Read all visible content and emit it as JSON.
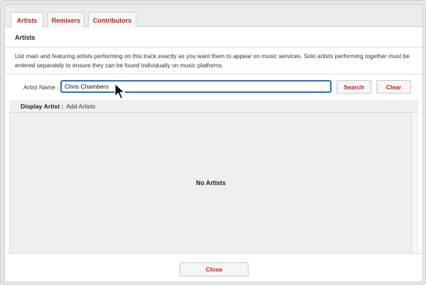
{
  "tabs": [
    {
      "label": "Artists",
      "active": true
    },
    {
      "label": "Remixers",
      "active": false
    },
    {
      "label": "Contributors",
      "active": false
    }
  ],
  "section_title": "Artists",
  "description": "List main and featuring artists performing on this track exactly as you want them to appear on music services. Solo artists performing together must be entered separately to ensure they can be found individually on music platforms.",
  "search": {
    "label": "Artist Name :",
    "value": "Chris Chambers",
    "search_label": "Search",
    "clear_label": "Clear"
  },
  "display_artist": {
    "label": "Display Artist :",
    "value": "Add Artists"
  },
  "artists_list": {
    "empty_text": "No Artists"
  },
  "footer": {
    "close_label": "Close"
  },
  "colors": {
    "accent": "#b3261e",
    "input_focus": "#2d6db5"
  },
  "icons": {
    "cursor": "mouse-pointer-icon"
  }
}
